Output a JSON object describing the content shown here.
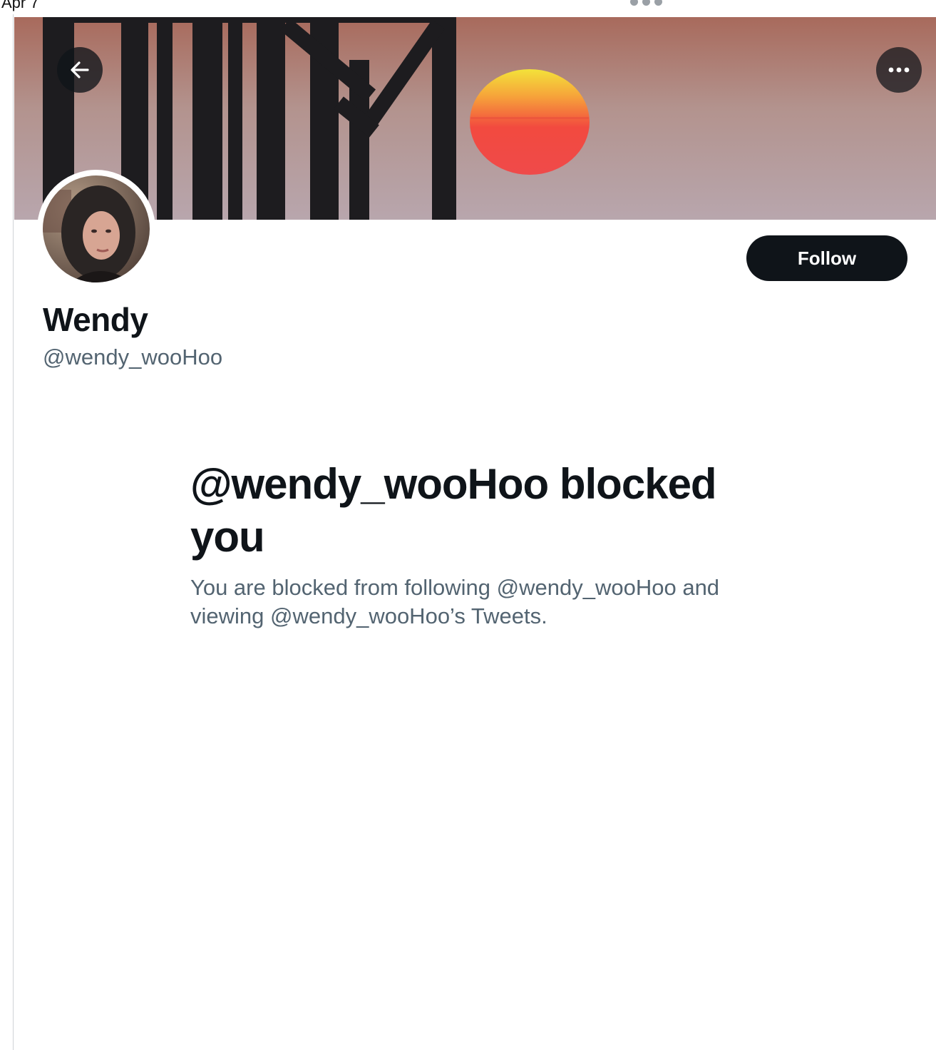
{
  "status_bar": {
    "date": "Apr 7"
  },
  "header": {
    "back_icon": "arrow-left-icon",
    "more_icon": "more-horizontal-icon"
  },
  "profile": {
    "display_name": "Wendy",
    "handle": "@wendy_wooHoo",
    "follow_label": "Follow"
  },
  "blocked": {
    "title": "@wendy_wooHoo blocked you",
    "description": "You are blocked from following @wendy_wooHoo and viewing @wendy_wooHoo’s Tweets."
  },
  "colors": {
    "text_primary": "#0f1419",
    "text_secondary": "#536471",
    "button_bg": "#0f1419",
    "button_text": "#ffffff"
  }
}
